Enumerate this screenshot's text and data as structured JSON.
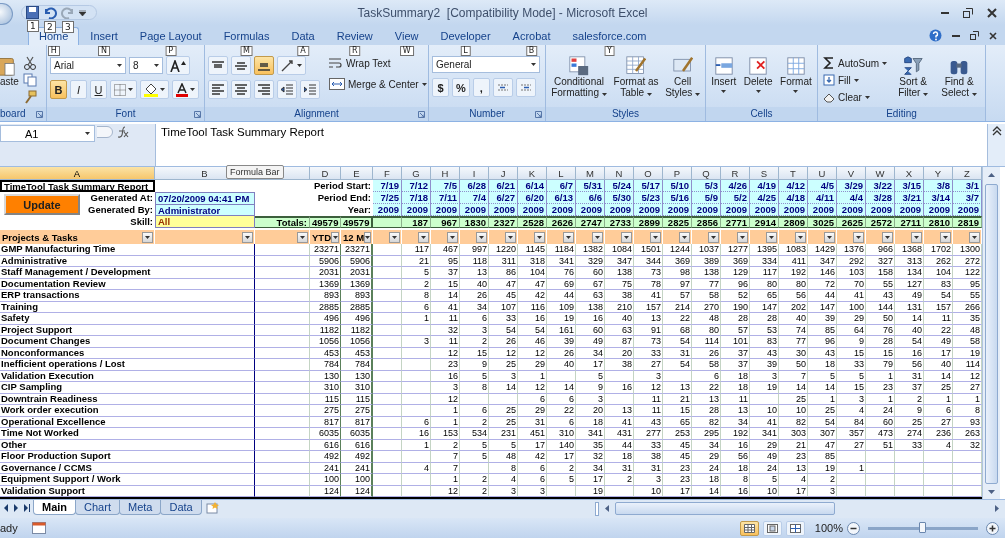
{
  "window": {
    "title": "TaskSummary2  [Compatibility Mode] - Microsoft Excel",
    "quick_access_keytips": [
      "1",
      "2",
      "3"
    ]
  },
  "tabs": [
    {
      "label": "Home",
      "keytip": "H",
      "selected": true
    },
    {
      "label": "Insert",
      "keytip": "N",
      "selected": false
    },
    {
      "label": "Page Layout",
      "keytip": "P",
      "selected": false
    },
    {
      "label": "Formulas",
      "keytip": "M",
      "selected": false
    },
    {
      "label": "Data",
      "keytip": "A",
      "selected": false
    },
    {
      "label": "Review",
      "keytip": "R",
      "selected": false
    },
    {
      "label": "View",
      "keytip": "W",
      "selected": false
    },
    {
      "label": "Developer",
      "keytip": "L",
      "selected": false
    },
    {
      "label": "Acrobat",
      "keytip": "B",
      "selected": false
    },
    {
      "label": "salesforce.com",
      "keytip": "Y",
      "selected": false
    }
  ],
  "ribbon": {
    "clipboard": {
      "paste": "aste",
      "label": "board"
    },
    "font": {
      "name": "Arial",
      "size": "8",
      "styles": [
        {
          "label": "B",
          "on": true
        },
        {
          "label": "I",
          "on": false
        },
        {
          "label": "U",
          "on": false
        }
      ],
      "label": "Font"
    },
    "alignment": {
      "vertical": [
        {
          "on": false
        },
        {
          "on": false
        },
        {
          "on": true
        }
      ],
      "wrap": "Wrap Text",
      "merge": "Merge & Center",
      "label": "Alignment"
    },
    "number": {
      "format": "General",
      "symbols": [
        "$",
        "%",
        ","
      ],
      "label": "Number"
    },
    "styles": {
      "buttons": [
        "Conditional Formatting",
        "Format as Table",
        "Cell Styles"
      ],
      "label": "Styles"
    },
    "cells": {
      "buttons": [
        "Insert",
        "Delete",
        "Format"
      ],
      "label": "Cells"
    },
    "editing": {
      "small": [
        "AutoSum",
        "Fill",
        "Clear"
      ],
      "large": [
        "Sort & Filter",
        "Find & Select"
      ],
      "label": "Editing"
    }
  },
  "formula_bar": {
    "name_box": "A1",
    "formula": "TimeTool Task Summary Report",
    "tooltip": "Formula Bar"
  },
  "column_headers": [
    {
      "letter": "A",
      "selected": true
    },
    {
      "letter": "B",
      "selected": false
    },
    {
      "selected": false
    },
    {
      "letter": "D",
      "selected": false
    },
    {
      "letter": "E",
      "selected": false
    },
    {
      "letter": "F",
      "selected": false
    },
    {
      "letter": "G",
      "selected": false
    },
    {
      "letter": "H",
      "selected": false
    },
    {
      "letter": "I",
      "selected": false
    },
    {
      "letter": "J",
      "selected": false
    },
    {
      "letter": "K",
      "selected": false
    },
    {
      "letter": "L",
      "selected": false
    },
    {
      "letter": "M",
      "selected": false
    },
    {
      "letter": "N",
      "selected": false
    },
    {
      "letter": "O",
      "selected": false
    },
    {
      "letter": "P",
      "selected": false
    },
    {
      "letter": "Q",
      "selected": false
    },
    {
      "letter": "R",
      "selected": false
    },
    {
      "letter": "S",
      "selected": false
    },
    {
      "letter": "T",
      "selected": false
    },
    {
      "letter": "U",
      "selected": false
    },
    {
      "letter": "V",
      "selected": false
    },
    {
      "letter": "W",
      "selected": false
    },
    {
      "letter": "X",
      "selected": false
    },
    {
      "letter": "Y",
      "selected": false
    },
    {
      "letter": "Z",
      "selected": false
    }
  ],
  "report": {
    "title": "TimeTool Task Summary Report",
    "update_button": "Update",
    "generated_at_label": "Generated At:",
    "generated_at": "07/20/2009 04:41 PM",
    "generated_by_label": "Generated By:",
    "generated_by": "Administrator",
    "skill_label": "Skill:",
    "skill": "All",
    "totals_label": "Totals:",
    "ytd_total": "49579",
    "m12_total": "49579",
    "period_start_label": "Period Start:",
    "period_end_label": "Period End:",
    "year_label": "Year:"
  },
  "weeks": [
    {
      "start": "7/19",
      "end": "7/25",
      "year": "2009"
    },
    {
      "start": "7/12",
      "end": "7/18",
      "year": "2009",
      "total": "187"
    },
    {
      "start": "7/5",
      "end": "7/11",
      "year": "2009",
      "total": "967"
    },
    {
      "start": "6/28",
      "end": "7/4",
      "year": "2009",
      "total": "1830"
    },
    {
      "start": "6/21",
      "end": "6/27",
      "year": "2009",
      "total": "2327"
    },
    {
      "start": "6/14",
      "end": "6/20",
      "year": "2009",
      "total": "2528"
    },
    {
      "start": "6/7",
      "end": "6/13",
      "year": "2009",
      "total": "2626"
    },
    {
      "start": "5/31",
      "end": "6/6",
      "year": "2009",
      "total": "2747"
    },
    {
      "start": "5/24",
      "end": "5/30",
      "year": "2009",
      "total": "2733"
    },
    {
      "start": "5/17",
      "end": "5/23",
      "year": "2009",
      "total": "2899"
    },
    {
      "start": "5/10",
      "end": "5/16",
      "year": "2009",
      "total": "2825"
    },
    {
      "start": "5/3",
      "end": "5/9",
      "year": "2009",
      "total": "2856"
    },
    {
      "start": "4/26",
      "end": "5/2",
      "year": "2009",
      "total": "2771"
    },
    {
      "start": "4/19",
      "end": "4/25",
      "year": "2009",
      "total": "2914"
    },
    {
      "start": "4/12",
      "end": "4/18",
      "year": "2009",
      "total": "2809"
    },
    {
      "start": "4/5",
      "end": "4/11",
      "year": "2009",
      "total": "3025"
    },
    {
      "start": "3/29",
      "end": "4/4",
      "year": "2009",
      "total": "2625"
    },
    {
      "start": "3/22",
      "end": "3/28",
      "year": "2009",
      "total": "2572"
    },
    {
      "start": "3/15",
      "end": "3/21",
      "year": "2009",
      "total": "2711"
    },
    {
      "start": "3/8",
      "end": "3/14",
      "year": "2009",
      "total": "2810"
    },
    {
      "start": "3/1",
      "end": "3/7",
      "year": "2009",
      "total": "2819"
    }
  ],
  "table": {
    "task_header": "Projects & Tasks",
    "ytd_header": "YTD",
    "m12_header": "12 M",
    "rows": [
      {
        "task": "GMP Manufacturing Time",
        "ytd": "23271",
        "m12": "23271",
        "weeks": [
          {
            "kind": "blank"
          },
          "117",
          "467",
          "997",
          "1220",
          "1145",
          "1184",
          "1382",
          "1084",
          "1501",
          "1244",
          "1037",
          "1277",
          "1395",
          "1083",
          "1429",
          "1376",
          "966",
          "1368",
          "1702",
          "1300"
        ]
      },
      {
        "task": "Administrative",
        "ytd": "5906",
        "m12": "5906",
        "weeks": [
          {
            "kind": "blank"
          },
          "21",
          "95",
          "118",
          "311",
          "318",
          "341",
          "329",
          "347",
          "344",
          "369",
          "389",
          "369",
          "334",
          "411",
          "347",
          "292",
          "327",
          "313",
          "262",
          "272"
        ]
      },
      {
        "task": "Staff Management / Development",
        "ytd": "2031",
        "m12": "2031",
        "weeks": [
          {
            "kind": "blank"
          },
          "5",
          "37",
          "13",
          "86",
          "104",
          "76",
          "60",
          "138",
          "73",
          "98",
          "138",
          "129",
          "117",
          "192",
          "146",
          "103",
          "158",
          "134",
          "104",
          "122"
        ]
      },
      {
        "task": "Documentation Review",
        "ytd": "1369",
        "m12": "1369",
        "weeks": [
          {
            "kind": "blank"
          },
          "2",
          "15",
          "40",
          "47",
          "47",
          "69",
          "67",
          "75",
          "78",
          "97",
          "77",
          "96",
          "80",
          "80",
          "72",
          "70",
          "55",
          "127",
          "83",
          "95"
        ]
      },
      {
        "task": "ERP transactions",
        "ytd": "893",
        "m12": "893",
        "weeks": [
          {
            "kind": "blank"
          },
          "8",
          "14",
          "26",
          "45",
          "42",
          "44",
          "63",
          "38",
          "41",
          "57",
          "58",
          "52",
          "65",
          "56",
          "44",
          "41",
          "43",
          "49",
          "54",
          "55"
        ]
      },
      {
        "task": "Training",
        "ytd": "2885",
        "m12": "2885",
        "weeks": [
          {
            "kind": "blank"
          },
          "6",
          "41",
          "34",
          "107",
          "116",
          "109",
          "138",
          "210",
          "157",
          "214",
          "270",
          "190",
          "147",
          "202",
          "147",
          "100",
          "144",
          "131",
          "157",
          "266"
        ]
      },
      {
        "task": "Safety",
        "ytd": "496",
        "m12": "496",
        "weeks": [
          {
            "kind": "blank"
          },
          "1",
          "11",
          "6",
          "33",
          "16",
          "19",
          "16",
          "40",
          "13",
          "22",
          "48",
          "28",
          "28",
          "40",
          "39",
          "29",
          "50",
          "14",
          "11",
          "35"
        ]
      },
      {
        "task": "Project Support",
        "ytd": "1182",
        "m12": "1182",
        "weeks": [
          {
            "kind": "blank"
          },
          {
            "kind": "blank"
          },
          "32",
          "3",
          "54",
          "54",
          "161",
          "60",
          "63",
          "91",
          "68",
          "80",
          "57",
          "53",
          "74",
          "85",
          "64",
          "76",
          "40",
          "22",
          "48"
        ]
      },
      {
        "task": "Document Changes",
        "ytd": "1056",
        "m12": "1056",
        "weeks": [
          {
            "kind": "blank"
          },
          "3",
          "11",
          "2",
          "26",
          "46",
          "39",
          "49",
          "87",
          "73",
          "54",
          "114",
          "101",
          "83",
          "77",
          "96",
          "9",
          "28",
          "54",
          "49",
          "58"
        ]
      },
      {
        "task": "Nonconformances",
        "ytd": "453",
        "m12": "453",
        "weeks": [
          {
            "kind": "blank"
          },
          {
            "kind": "blank"
          },
          "12",
          "15",
          "12",
          "12",
          "26",
          "34",
          "20",
          "33",
          "31",
          "26",
          "37",
          "43",
          "30",
          "43",
          "15",
          "15",
          "16",
          "17",
          "19"
        ]
      },
      {
        "task": "Inefficient operations / Lost",
        "ytd": "784",
        "m12": "784",
        "weeks": [
          {
            "kind": "blank"
          },
          {
            "kind": "blank"
          },
          "23",
          "9",
          "25",
          "29",
          "40",
          "17",
          "38",
          "27",
          "54",
          "58",
          "37",
          "39",
          "50",
          "18",
          "33",
          "79",
          "56",
          "40",
          "114"
        ]
      },
      {
        "task": "Validation Execution",
        "ytd": "130",
        "m12": "130",
        "weeks": [
          {
            "kind": "blank"
          },
          {
            "kind": "blank"
          },
          "16",
          "5",
          "3",
          "1",
          {
            "kind": "blank"
          },
          "5",
          {
            "kind": "blank"
          },
          "3",
          {
            "kind": "blank"
          },
          "6",
          "18",
          "3",
          "7",
          "5",
          "5",
          "1",
          "31",
          "14",
          "12"
        ]
      },
      {
        "task": "CIP Sampling",
        "ytd": "310",
        "m12": "310",
        "weeks": [
          {
            "kind": "blank"
          },
          {
            "kind": "blank"
          },
          "3",
          "8",
          "14",
          "12",
          "14",
          "9",
          "16",
          "12",
          "13",
          "22",
          "18",
          "19",
          "14",
          "14",
          "15",
          "23",
          "37",
          "25",
          "27"
        ]
      },
      {
        "task": "Downtrain Readiness",
        "ytd": "115",
        "m12": "115",
        "weeks": [
          {
            "kind": "blank"
          },
          {
            "kind": "blank"
          },
          "12",
          {
            "kind": "blank"
          },
          {
            "kind": "blank"
          },
          "6",
          "6",
          "3",
          {
            "kind": "blank"
          },
          "11",
          "21",
          "13",
          "11",
          {
            "kind": "blank"
          },
          "25",
          "1",
          "3",
          "1",
          "2",
          "1",
          "1"
        ]
      },
      {
        "task": "Work order execution",
        "ytd": "275",
        "m12": "275",
        "weeks": [
          {
            "kind": "blank"
          },
          {
            "kind": "blank"
          },
          "1",
          "6",
          "25",
          "29",
          "22",
          "20",
          "13",
          "11",
          "15",
          "28",
          "13",
          "10",
          "10",
          "25",
          "4",
          "24",
          "9",
          "6",
          "8"
        ]
      },
      {
        "task": "Operational Excellence",
        "ytd": "817",
        "m12": "817",
        "weeks": [
          {
            "kind": "blank"
          },
          "6",
          "1",
          "2",
          "25",
          "31",
          "6",
          "18",
          "41",
          "43",
          "65",
          "82",
          "34",
          "41",
          "82",
          "54",
          "84",
          "60",
          "25",
          "27",
          "93"
        ]
      },
      {
        "task": "Time Not Worked",
        "ytd": "6035",
        "m12": "6035",
        "weeks": [
          {
            "kind": "blank"
          },
          "16",
          "153",
          "534",
          "231",
          "451",
          "310",
          "341",
          "431",
          "277",
          "253",
          "295",
          "192",
          "341",
          "303",
          "307",
          "357",
          "473",
          "274",
          "236",
          "263"
        ]
      },
      {
        "task": "Other",
        "ytd": "616",
        "m12": "616",
        "weeks": [
          {
            "kind": "blank"
          },
          "1",
          "2",
          "5",
          "5",
          "17",
          "140",
          "35",
          "44",
          "33",
          "45",
          "34",
          "16",
          "29",
          "21",
          "47",
          "27",
          "51",
          "33",
          "4",
          "32"
        ]
      },
      {
        "task": "Floor Production Suport",
        "ytd": "492",
        "m12": "492",
        "weeks": [
          {
            "kind": "blank"
          },
          {
            "kind": "blank"
          },
          "7",
          "5",
          "48",
          "42",
          "17",
          "32",
          "18",
          "38",
          "45",
          "29",
          "56",
          "49",
          "23",
          "85",
          {
            "kind": "blank"
          },
          {
            "kind": "blank"
          },
          {
            "kind": "blank"
          },
          {
            "kind": "blank"
          },
          {
            "kind": "blank"
          }
        ]
      },
      {
        "task": "Governance / CCMS",
        "ytd": "241",
        "m12": "241",
        "weeks": [
          {
            "kind": "blank"
          },
          "4",
          "7",
          {
            "kind": "blank"
          },
          "8",
          "6",
          "2",
          "34",
          "31",
          "31",
          "23",
          "24",
          "18",
          "24",
          "13",
          "19",
          "1",
          {
            "kind": "blank"
          },
          {
            "kind": "blank"
          },
          {
            "kind": "blank"
          },
          {
            "kind": "blank"
          }
        ]
      },
      {
        "task": "Equipment Support / Work",
        "ytd": "100",
        "m12": "100",
        "weeks": [
          {
            "kind": "blank"
          },
          {
            "kind": "blank"
          },
          "1",
          "2",
          "4",
          "6",
          "5",
          "17",
          "2",
          "3",
          "23",
          "18",
          "8",
          "5",
          "4",
          "2",
          {
            "kind": "blank"
          },
          {
            "kind": "blank"
          },
          {
            "kind": "blank"
          },
          {
            "kind": "blank"
          },
          {
            "kind": "blank"
          }
        ]
      },
      {
        "task": "Validation Support",
        "ytd": "124",
        "m12": "124",
        "weeks": [
          {
            "kind": "blank"
          },
          {
            "kind": "blank"
          },
          "12",
          "2",
          "3",
          "3",
          {
            "kind": "blank"
          },
          "19",
          {
            "kind": "blank"
          },
          "10",
          "17",
          "14",
          "16",
          "10",
          "17",
          "3",
          {
            "kind": "blank"
          },
          {
            "kind": "blank"
          },
          {
            "kind": "blank"
          },
          {
            "kind": "blank"
          },
          {
            "kind": "blank"
          }
        ]
      }
    ]
  },
  "sheet_tabs": [
    {
      "label": "Main",
      "selected": true
    },
    {
      "label": "Chart",
      "selected": false
    },
    {
      "label": "Meta",
      "selected": false
    },
    {
      "label": "Data",
      "selected": false
    }
  ],
  "status_bar": {
    "status": "ady",
    "zoom": {
      "label": "100%",
      "level": 0.5
    }
  }
}
